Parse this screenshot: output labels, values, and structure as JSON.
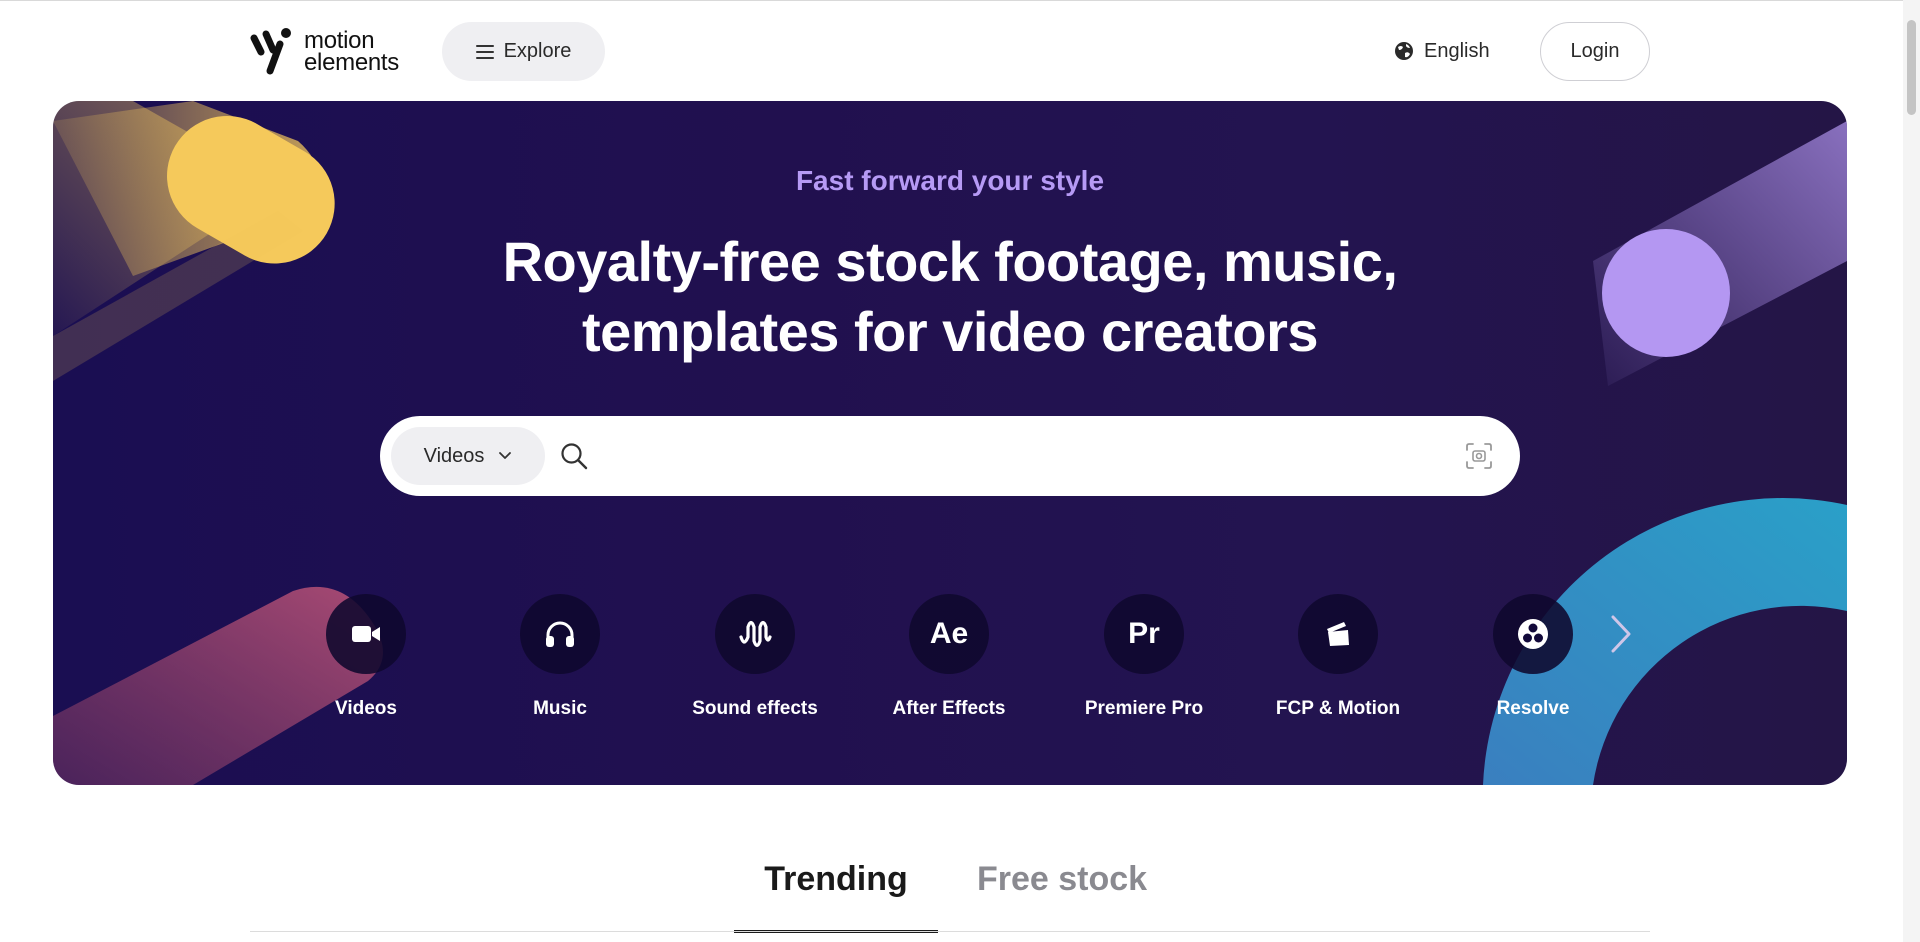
{
  "header": {
    "logo": {
      "line1": "motion",
      "line2": "elements"
    },
    "explore_label": "Explore",
    "language_label": "English",
    "login_label": "Login"
  },
  "hero": {
    "subtitle": "Fast forward your style",
    "title_line1": "Royalty-free stock footage, music,",
    "title_line2": "templates for video creators",
    "search": {
      "type_selected": "Videos",
      "query": "",
      "placeholder": ""
    },
    "categories": [
      {
        "label": "Videos",
        "icon": "video-camera-icon"
      },
      {
        "label": "Music",
        "icon": "headphones-icon"
      },
      {
        "label": "Sound effects",
        "icon": "sound-wave-icon"
      },
      {
        "label": "After Effects",
        "icon": "after-effects-icon",
        "glyph": "Ae"
      },
      {
        "label": "Premiere Pro",
        "icon": "premiere-pro-icon",
        "glyph": "Pr"
      },
      {
        "label": "FCP & Motion",
        "icon": "clapperboard-icon"
      },
      {
        "label": "Resolve",
        "icon": "resolve-icon"
      }
    ],
    "colors": {
      "background": "#1a0e52",
      "subtitle": "#b69af5",
      "yellow_shape": "#f5c95b",
      "purple_circle": "#b497f2",
      "blue_arc": "#2f8fc0",
      "pink_shape": "#a44a6c"
    }
  },
  "tabs": [
    {
      "label": "Trending",
      "active": true
    },
    {
      "label": "Free stock",
      "active": false
    }
  ]
}
